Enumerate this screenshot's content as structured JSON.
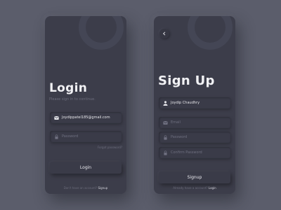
{
  "colors": {
    "background": "#5b5d6b",
    "card": "#3c3d4a",
    "text": "#f1f1f4",
    "muted": "#6c6d7c"
  },
  "login": {
    "title": "Login",
    "subtitle": "Please sign in to continue.",
    "email": {
      "value": "Joydippatel185@gmail.com",
      "icon": "mail-icon"
    },
    "password": {
      "placeholder": "Password",
      "icon": "lock-icon"
    },
    "forgot_label": "Forgot password?",
    "button_label": "Login",
    "footer_text": "Don't have an account?",
    "footer_link": "Signup"
  },
  "signup": {
    "back_icon": "chevron-left-icon",
    "title": "Sign Up",
    "name": {
      "value": "Joydip Chaudhry",
      "icon": "user-icon"
    },
    "email": {
      "placeholder": "Email",
      "icon": "mail-icon"
    },
    "password": {
      "placeholder": "Password",
      "icon": "lock-icon"
    },
    "confirm_password": {
      "placeholder": "Confirm Password",
      "icon": "lock-icon"
    },
    "button_label": "Signup",
    "footer_text": "Already have a account?",
    "footer_link": "Login"
  }
}
